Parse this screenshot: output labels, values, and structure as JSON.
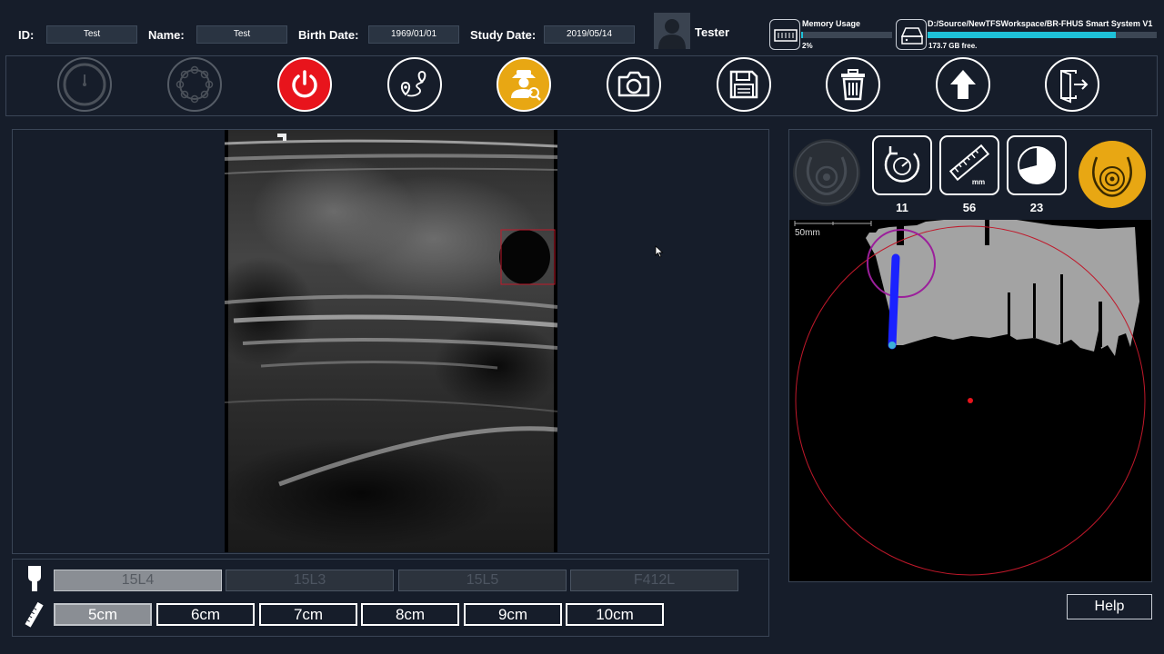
{
  "patient": {
    "id_label": "ID:",
    "id_value": "Test",
    "name_label": "Name:",
    "name_value": "Test",
    "birth_label": "Birth Date:",
    "birth_value": "1969/01/01",
    "study_label": "Study Date:",
    "study_value": "2019/05/14"
  },
  "user": {
    "name": "Tester",
    "icon": "user-avatar"
  },
  "memory": {
    "title": "Memory Usage",
    "percent_text": "2%",
    "level": 0.02,
    "icon": "memory-icon"
  },
  "disk": {
    "path": "D:/Source/NewTFSWorkspace/BR-FHUS Smart System V1",
    "free_text": "173.7 GB free.",
    "level": 0.82,
    "icon": "hard-drive-icon"
  },
  "toolbar": {
    "items": [
      {
        "name": "gauge",
        "icon": "gauge-icon",
        "enabled": false
      },
      {
        "name": "ring",
        "icon": "ring-icon",
        "enabled": false
      },
      {
        "name": "power",
        "icon": "power-icon",
        "enabled": true,
        "color": "#e8141c"
      },
      {
        "name": "route",
        "icon": "route-icon",
        "enabled": true
      },
      {
        "name": "inspector",
        "icon": "inspector-icon",
        "enabled": true,
        "color": "#e8a713"
      },
      {
        "name": "camera",
        "icon": "camera-icon",
        "enabled": true
      },
      {
        "name": "save",
        "icon": "floppy-icon",
        "enabled": true
      },
      {
        "name": "delete",
        "icon": "trash-icon",
        "enabled": true
      },
      {
        "name": "upload",
        "icon": "arrow-up-icon",
        "enabled": true
      },
      {
        "name": "exit",
        "icon": "exit-icon",
        "enabled": true
      }
    ]
  },
  "right_panel": {
    "tools": [
      {
        "icon": "rotation-gauge-icon",
        "value": "11"
      },
      {
        "icon": "ruler-mm-icon",
        "value": "56",
        "caption": "mm"
      },
      {
        "icon": "percent-pie-icon",
        "value": "23",
        "caption": "%"
      }
    ],
    "map_scale_label": "50mm"
  },
  "probes": {
    "items": [
      "15L4",
      "15L3",
      "15L5",
      "F412L"
    ],
    "selected": "15L4"
  },
  "depths": {
    "items": [
      "5cm",
      "6cm",
      "7cm",
      "8cm",
      "9cm",
      "10cm"
    ],
    "selected": "5cm"
  },
  "help_label": "Help",
  "colors": {
    "accent": "#1ec1d8",
    "power": "#e8141c",
    "highlight": "#e8a713",
    "roi": "#c0182a"
  }
}
